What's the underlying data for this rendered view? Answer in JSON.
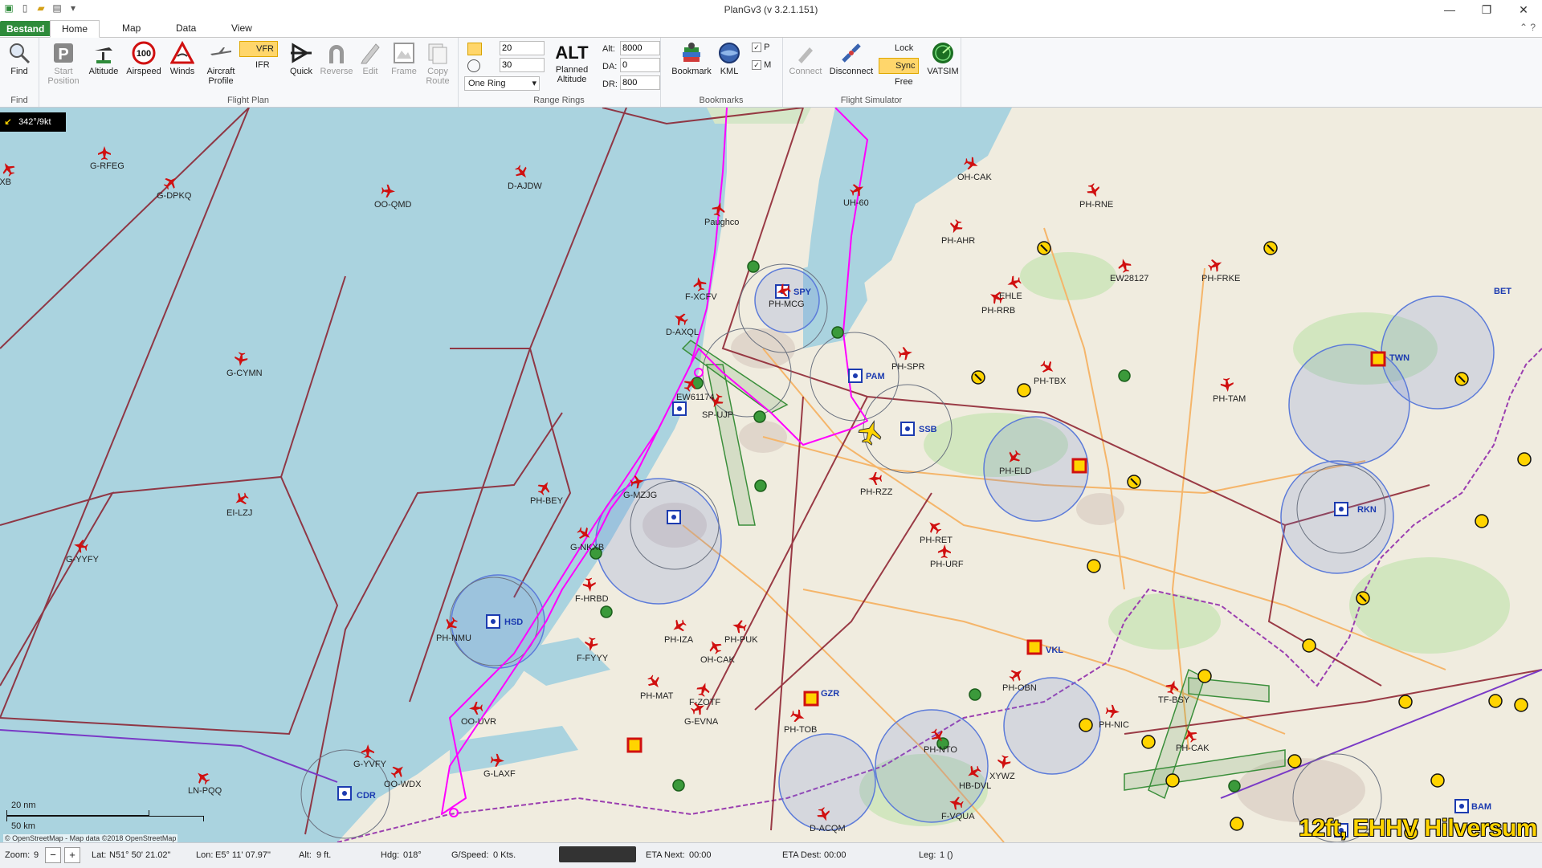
{
  "app": {
    "title": "PlanGv3 (v 3.2.1.151)"
  },
  "window": {
    "minimize": "—",
    "maximize": "❐",
    "close": "✕"
  },
  "tabs": {
    "file": "Bestand",
    "home": "Home",
    "map": "Map",
    "data": "Data",
    "view": "View"
  },
  "ribbon": {
    "find": {
      "label": "Find",
      "group": "Find"
    },
    "flight_plan": {
      "group": "Flight Plan",
      "start_position": "Start Position",
      "altitude": "Altitude",
      "airspeed": "Airspeed",
      "airspeed_value": "100",
      "winds": "Winds",
      "aircraft_profile": "Aircraft Profile",
      "vfr": "VFR",
      "ifr": "IFR",
      "quick": "Quick",
      "reverse": "Reverse",
      "edit": "Edit",
      "frame": "Frame",
      "copy_route": "Copy Route"
    },
    "range_rings": {
      "group": "Range Rings",
      "value1": "20",
      "value2": "30",
      "mode": "One Ring",
      "planned_altitude": "Planned Altitude",
      "alt_icon": "ALT",
      "alt_label": "Alt:",
      "alt_value": "8000",
      "da_label": "DA:",
      "da_value": "0",
      "dr_label": "DR:",
      "dr_value": "800"
    },
    "bookmarks": {
      "group": "Bookmarks",
      "bookmark": "Bookmark",
      "kml": "KML",
      "p": "P",
      "m": "M"
    },
    "flight_sim": {
      "group": "Flight Simulator",
      "connect": "Connect",
      "disconnect": "Disconnect",
      "lock": "Lock",
      "sync": "Sync",
      "free": "Free"
    },
    "vatsim": "VATSIM"
  },
  "map": {
    "wind": "342°/9kt",
    "scale_nm": "20 nm",
    "scale_km": "50 km",
    "attribution": "© OpenStreetMap - Map data ©2018 OpenStreetMap",
    "overlay_text": "12ft, EHHV Hilversum",
    "aircraft": [
      "G-RFEG",
      "G-DPKQ",
      "OO-QMD",
      "D-AJDW",
      "G-CYMN",
      "EI-LZJ",
      "G-YYFY",
      "KXB",
      "Paughco",
      "UH-60",
      "OH-CAK",
      "PH-RNE",
      "PH-AHR",
      "EHLE",
      "PH-RRB",
      "EW28127",
      "PH-BEY",
      "G-MZJG",
      "G-NKXB",
      "F-HRBD",
      "PH-NMU",
      "OO-UVR",
      "LN-PQQ",
      "G-YVFY",
      "OO-WDX",
      "G-LAXF",
      "PH-MAT",
      "F-FYYY",
      "PH-IZA",
      "PH-PUK",
      "OH-CAK",
      "F-ZOTF",
      "G-EVNA",
      "PH-TOB",
      "D-ACQM",
      "SP-UJP",
      "PH-MCG",
      "D-AXQL",
      "F-XCFV",
      "EW61174",
      "PH-SPR",
      "PH-TBX",
      "PH-TAM",
      "PH-ELD",
      "PH-RZZ",
      "PH-RET",
      "PH-URF",
      "PH-OBN",
      "PH-NIC",
      "PH-NTO",
      "XYWZ",
      "HB-DVL",
      "F-VQUA",
      "PH-CAK",
      "TF-BSY",
      "PH-FRKE"
    ],
    "navaids": [
      "SPY",
      "PAM",
      "SSB",
      "HSD",
      "GZR",
      "VKL",
      "TWN",
      "RKN",
      "CDR",
      "BET",
      "BAM"
    ]
  },
  "statusbar": {
    "zoom_label": "Zoom:",
    "zoom_value": "9",
    "lat_label": "Lat:",
    "lat_value": "N51° 50' 21.02\"",
    "lon_label": "Lon:",
    "lon_value": "E5° 11' 07.97\"",
    "alt_label": "Alt:",
    "alt_value": "9 ft.",
    "hdg_label": "Hdg:",
    "hdg_value": "018°",
    "gs_label": "G/Speed:",
    "gs_value": "0 Kts.",
    "eta_next_label": "ETA Next:",
    "eta_next_value": "00:00",
    "eta_dest_label": "ETA Dest:",
    "eta_dest_value": "00:00",
    "leg_label": "Leg:",
    "leg_value": "1 ()"
  },
  "colors": {
    "sea": "#aad3df",
    "land": "#f0ecdf",
    "route": "#ff00ff",
    "airspace": "#8b1c2b",
    "ctr": "#5c7bd9",
    "file_tab": "#2e8b3a"
  }
}
